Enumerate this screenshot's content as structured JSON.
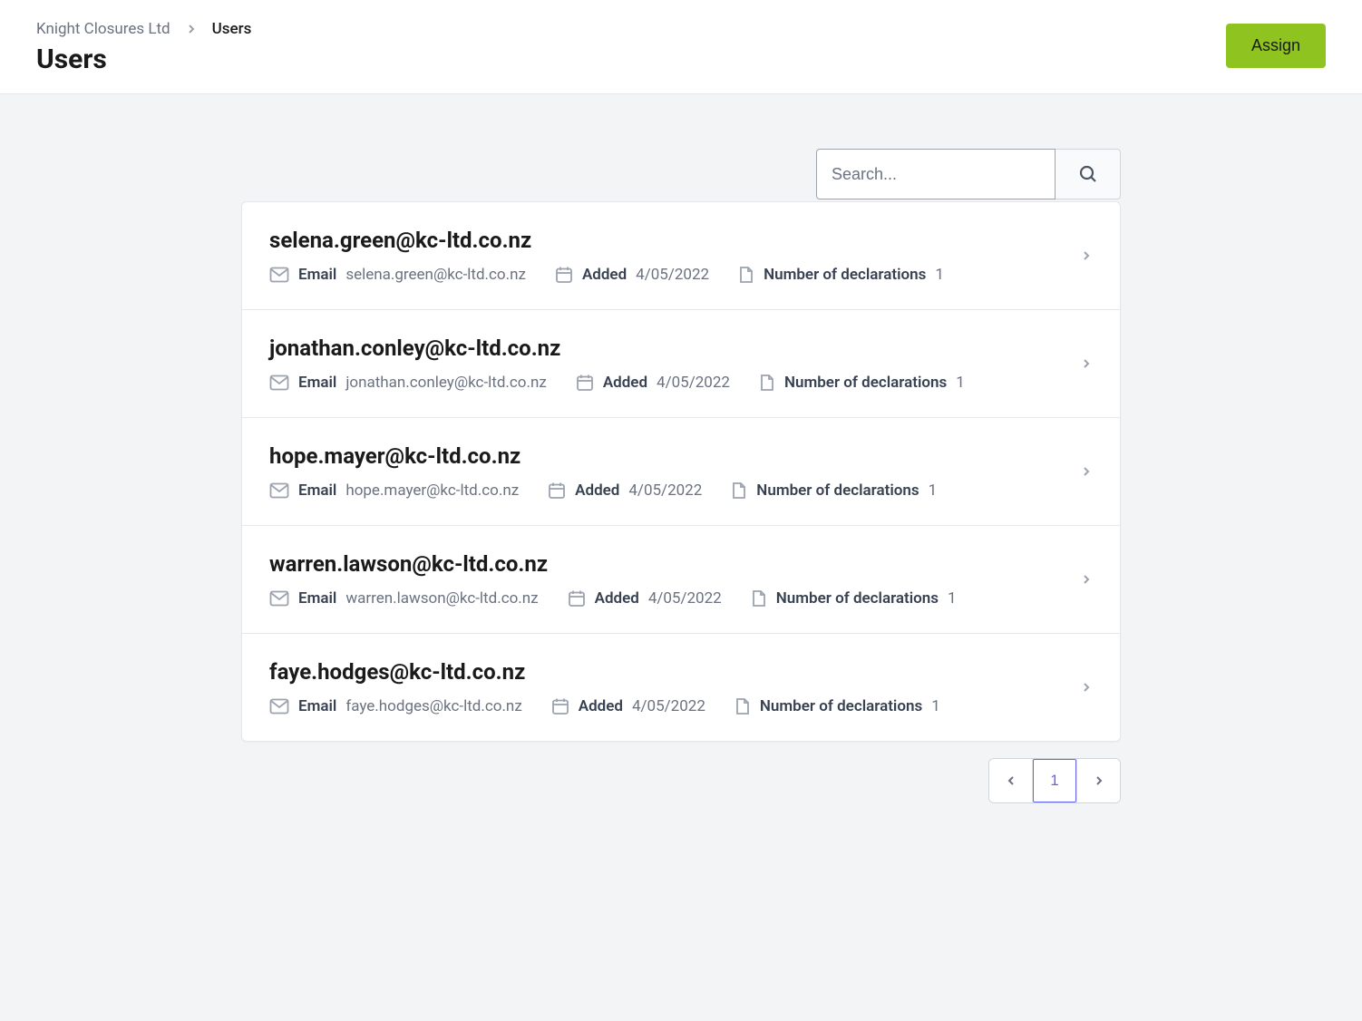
{
  "breadcrumb": {
    "org": "Knight Closures Ltd",
    "current": "Users"
  },
  "page_title": "Users",
  "assign_button": "Assign",
  "search": {
    "placeholder": "Search..."
  },
  "labels": {
    "email": "Email",
    "added": "Added",
    "declarations": "Number of declarations"
  },
  "users": [
    {
      "title": "selena.green@kc-ltd.co.nz",
      "email": "selena.green@kc-ltd.co.nz",
      "added": "4/05/2022",
      "declarations": "1"
    },
    {
      "title": "jonathan.conley@kc-ltd.co.nz",
      "email": "jonathan.conley@kc-ltd.co.nz",
      "added": "4/05/2022",
      "declarations": "1"
    },
    {
      "title": "hope.mayer@kc-ltd.co.nz",
      "email": "hope.mayer@kc-ltd.co.nz",
      "added": "4/05/2022",
      "declarations": "1"
    },
    {
      "title": "warren.lawson@kc-ltd.co.nz",
      "email": "warren.lawson@kc-ltd.co.nz",
      "added": "4/05/2022",
      "declarations": "1"
    },
    {
      "title": "faye.hodges@kc-ltd.co.nz",
      "email": "faye.hodges@kc-ltd.co.nz",
      "added": "4/05/2022",
      "declarations": "1"
    }
  ],
  "pagination": {
    "current": "1"
  }
}
